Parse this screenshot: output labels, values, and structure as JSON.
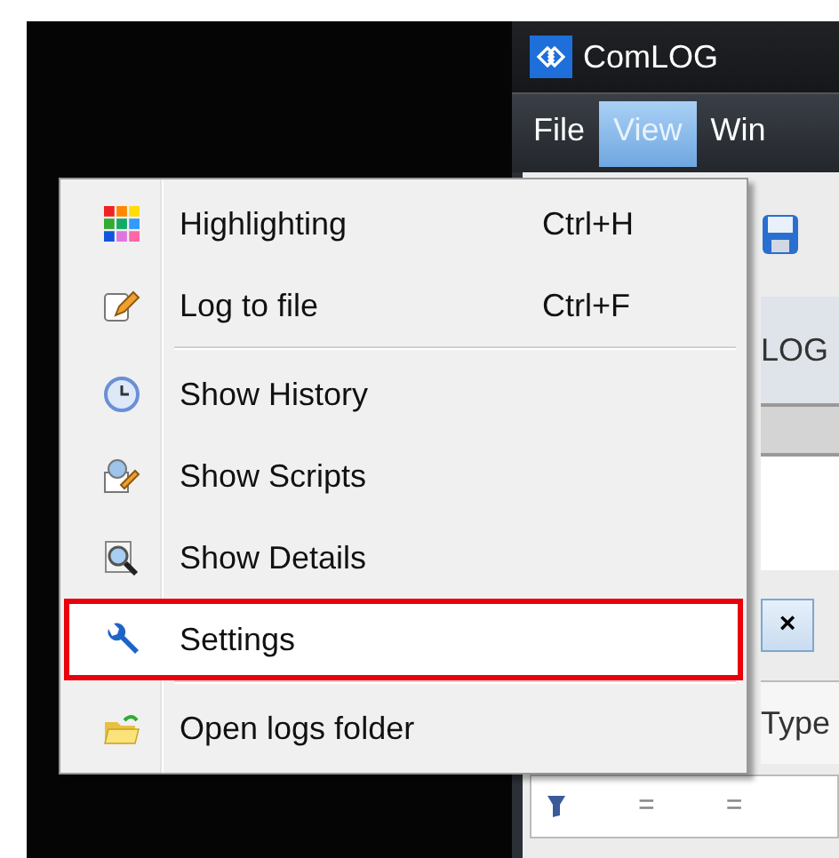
{
  "window": {
    "title": "ComLOG"
  },
  "menu_bar": [
    {
      "label": "File",
      "selected": false
    },
    {
      "label": "View",
      "selected": true
    },
    {
      "label": "Win",
      "selected": false
    }
  ],
  "tab": {
    "label": "LOG"
  },
  "close_button": {
    "label": "×"
  },
  "table": {
    "columns": [
      "Type"
    ],
    "filter_row": [
      "=",
      "="
    ]
  },
  "view_menu": {
    "groups": [
      [
        {
          "label": "Highlighting",
          "shortcut": "Ctrl+H",
          "highlighted": false
        },
        {
          "label": "Log to file",
          "shortcut": "Ctrl+F",
          "highlighted": false
        }
      ],
      [
        {
          "label": "Show History",
          "highlighted": false
        },
        {
          "label": "Show Scripts",
          "highlighted": false
        },
        {
          "label": "Show Details",
          "highlighted": false
        },
        {
          "label": "Settings",
          "highlighted": true
        }
      ],
      [
        {
          "label": "Open logs folder",
          "highlighted": false
        }
      ]
    ]
  }
}
